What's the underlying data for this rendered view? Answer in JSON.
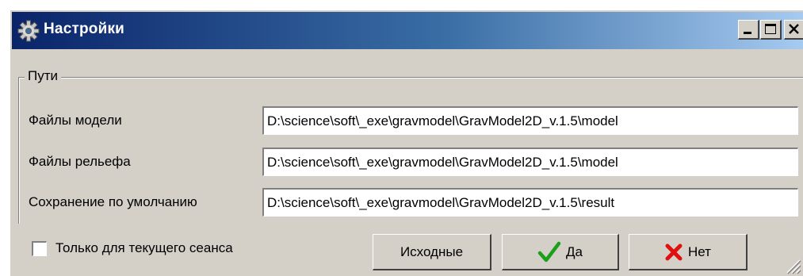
{
  "window": {
    "title": "Настройки",
    "title_icon": "gear-icon",
    "controls": {
      "minimize": "minimize-icon",
      "maximize": "maximize-icon",
      "close": "close-icon"
    }
  },
  "paths": {
    "group_label": "Пути",
    "rows": [
      {
        "label": "Файлы модели",
        "value": "D:\\science\\soft\\_exe\\gravmodel\\GravModel2D_v.1.5\\model"
      },
      {
        "label": "Файлы рельефа",
        "value": "D:\\science\\soft\\_exe\\gravmodel\\GravModel2D_v.1.5\\model"
      },
      {
        "label": "Сохранение по умолчанию",
        "value": "D:\\science\\soft\\_exe\\gravmodel\\GravModel2D_v.1.5\\result"
      }
    ]
  },
  "session_only": {
    "label": "Только для текущего сеанса",
    "checked": false
  },
  "buttons": {
    "defaults": "Исходные",
    "yes": "Да",
    "no": "Нет"
  },
  "colors": {
    "titlebar_start": "#0a246a",
    "titlebar_end": "#a6caf0",
    "face": "#d4d0c8",
    "check_green": "#1aa01a",
    "cross_red": "#e01010"
  }
}
